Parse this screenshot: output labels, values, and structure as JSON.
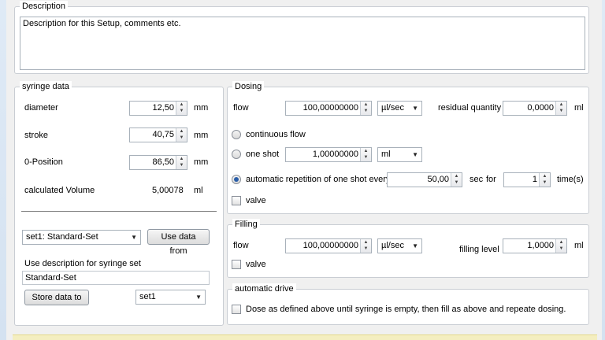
{
  "description": {
    "title": "Description",
    "text": "Description for this Setup, comments etc."
  },
  "syringe": {
    "title": "syringe data",
    "diameter_label": "diameter",
    "diameter_value": "12,50",
    "diameter_unit": "mm",
    "stroke_label": "stroke",
    "stroke_value": "40,75",
    "stroke_unit": "mm",
    "zero_label": "0-Position",
    "zero_value": "86,50",
    "zero_unit": "mm",
    "volume_label": "calculated Volume",
    "volume_value": "5,00078",
    "volume_unit": "ml",
    "set_select": "set1: Standard-Set",
    "use_data_button": "Use data from",
    "use_desc_label": "Use description for syringe set",
    "desc_value": "Standard-Set",
    "store_button": "Store data to",
    "store_select": "set1"
  },
  "dosing": {
    "title": "Dosing",
    "flow_label": "flow",
    "flow_value": "100,00000000",
    "flow_unit": "µl/sec",
    "residual_label": "residual quantity",
    "residual_value": "0,0000",
    "residual_unit": "ml",
    "continuous_label": "continuous flow",
    "oneshot_label": "one shot",
    "oneshot_value": "1,00000000",
    "oneshot_unit": "ml",
    "repeat_label": "automatic repetition of one shot every",
    "repeat_value": "50,00",
    "repeat_unit": "sec",
    "for_label": "for",
    "times_value": "1",
    "times_label": "time(s)",
    "valve_label": "valve"
  },
  "filling": {
    "title": "Filling",
    "flow_label": "flow",
    "flow_value": "100,00000000",
    "flow_unit": "µl/sec",
    "level_label": "filling level",
    "level_value": "1,0000",
    "level_unit": "ml",
    "valve_label": "valve"
  },
  "auto": {
    "title": "automatic drive",
    "checkbox_label": "Dose as defined above until syringe is empty, then fill as above and repeate dosing."
  }
}
